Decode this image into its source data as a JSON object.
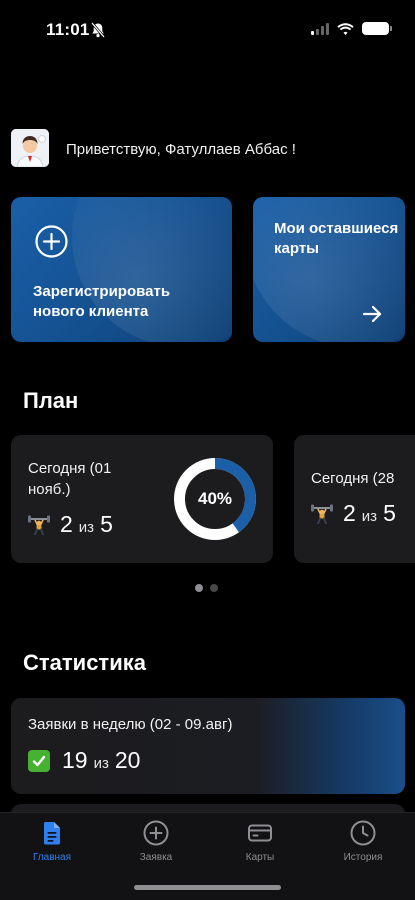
{
  "status_bar": {
    "time": "11:01"
  },
  "greeting": {
    "text": "Приветствую, Фатуллаев Аббас !"
  },
  "actions": {
    "register_label": "Зарегистрировать нового клиента",
    "cards_label": "Мои оставшиеся карты"
  },
  "plan": {
    "title": "План",
    "cards": [
      {
        "date": "Сегодня (01 нояб.)",
        "done": "2",
        "of": "из",
        "total": "5",
        "percent_label": "40%",
        "progress": 0.4
      },
      {
        "date": "Сегодня (28",
        "done": "2",
        "of": "из",
        "total": "5"
      }
    ],
    "page_count": 2,
    "active_page": 0
  },
  "stats": {
    "title": "Статистика",
    "card": {
      "title": "Заявки в неделю (02 - 09.авг)",
      "done": "19",
      "of": "из",
      "total": "20"
    }
  },
  "tab_bar": {
    "tabs": [
      {
        "label": "Главная",
        "icon": "document-icon",
        "active": true
      },
      {
        "label": "Заявка",
        "icon": "plus-circle-icon",
        "active": false
      },
      {
        "label": "Карты",
        "icon": "credit-card-icon",
        "active": false
      },
      {
        "label": "История",
        "icon": "clock-icon",
        "active": false
      }
    ]
  },
  "colors": {
    "accent": "#2f7ff0",
    "card_blue": "#1a5fa8",
    "surface": "#1c1c1e",
    "success": "#47b232"
  }
}
